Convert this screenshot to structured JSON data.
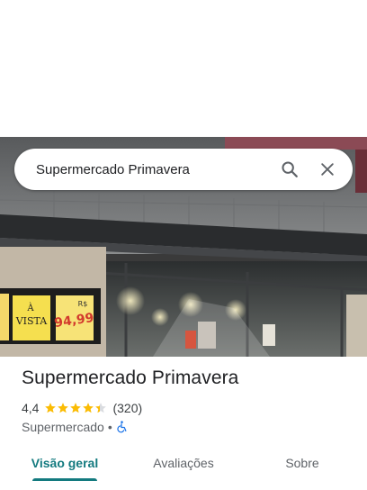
{
  "search": {
    "value": "Supermercado Primavera",
    "search_icon": "search-icon",
    "close_icon": "close-icon"
  },
  "photo": {
    "sign_price_currency": "R$",
    "sign_price": "94,99",
    "sign_left_text_1": "À",
    "sign_left_text_2": "VISTA"
  },
  "place": {
    "title": "Supermercado Primavera",
    "rating": "4,4",
    "stars": 4.4,
    "review_count": "(320)",
    "category": "Supermercado",
    "separator": "•",
    "accessibility_icon": "wheelchair-icon"
  },
  "tabs": [
    {
      "label": "Visão geral",
      "active": true
    },
    {
      "label": "Avaliações",
      "active": false
    },
    {
      "label": "Sobre",
      "active": false
    }
  ],
  "colors": {
    "accent": "#137a7f",
    "star": "#fbbc04",
    "accessibility": "#1a73e8"
  }
}
